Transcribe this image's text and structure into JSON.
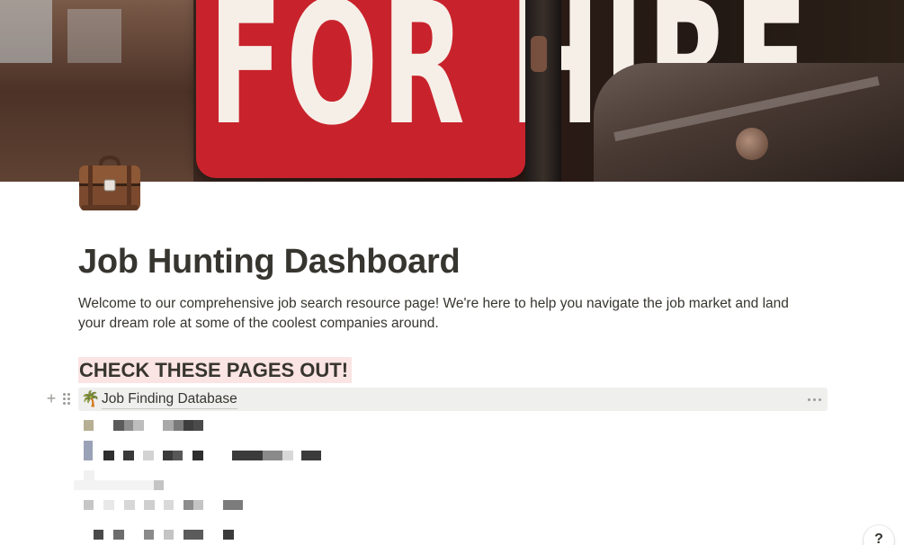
{
  "cover": {
    "sign_text": "FOR HIRE"
  },
  "page": {
    "icon": "briefcase-icon",
    "title": "Job Hunting Dashboard",
    "intro": "Welcome to our comprehensive job search resource page! We're here to help you navigate the job market and land your dream role at some of the coolest companies around."
  },
  "section": {
    "heading": "CHECK THESE PAGES OUT!",
    "heading_highlight": "#fbe4e4",
    "linked_page": {
      "icon": "🌴",
      "label": "Job Finding Database"
    }
  },
  "controls": {
    "add_block": "+",
    "help": "?"
  }
}
